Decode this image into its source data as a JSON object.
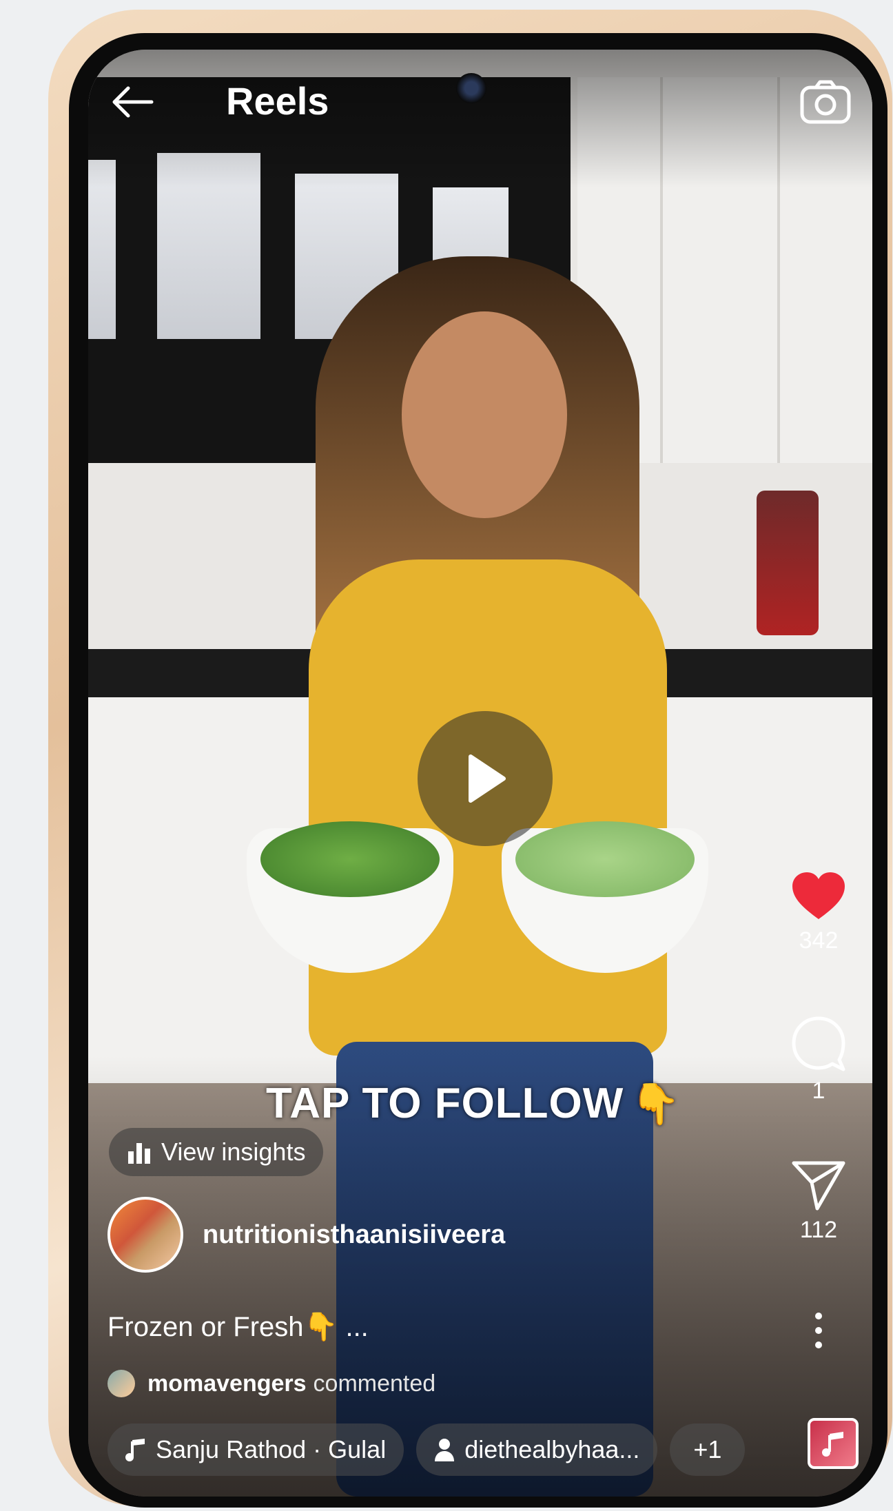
{
  "header": {
    "back_icon": "arrow-left-icon",
    "title": "Reels",
    "camera_icon": "camera-icon"
  },
  "video": {
    "overlay_text": "TAP TO FOLLOW",
    "overlay_emoji": "👇",
    "play_icon": "play-icon"
  },
  "actions": {
    "like_count": "342",
    "comment_count": "1",
    "share_count": "112",
    "like_color": "#ed2a3a"
  },
  "insights": {
    "label": "View insights"
  },
  "author": {
    "username": "nutritionisthaanisiiveera"
  },
  "caption": {
    "text": "Frozen or Fresh👇 ..."
  },
  "comment_preview": {
    "username": "momavengers",
    "action": "commented"
  },
  "bottom_bar": {
    "audio_label": "Sanju Rathod · Gulal",
    "collab_label": "diethealbyhaa...",
    "more_label": "+1"
  }
}
